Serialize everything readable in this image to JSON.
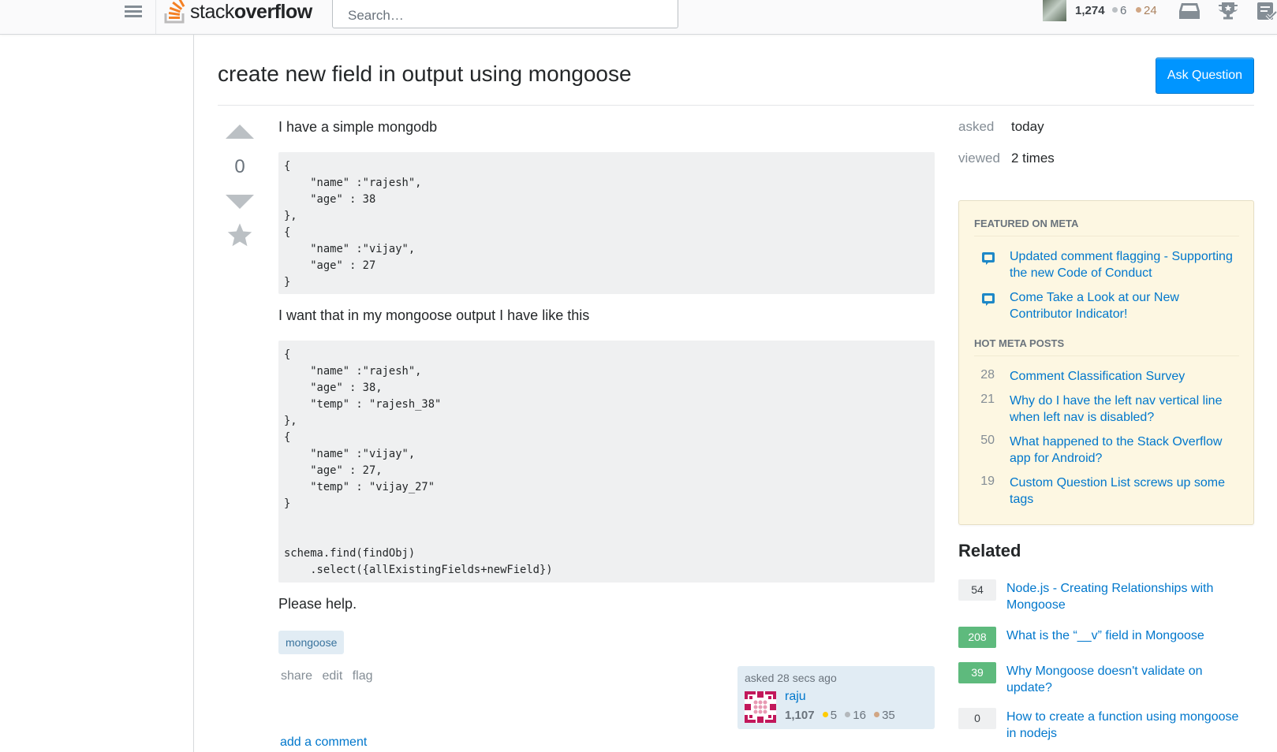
{
  "topbar": {
    "logo_light": "stack",
    "logo_bold": "overflow",
    "search_placeholder": "Search…",
    "reputation": "1,274",
    "silver_badges": "6",
    "bronze_badges": "24",
    "icons": [
      "hamburger-menu-icon",
      "inbox-icon",
      "achievements-trophy-icon",
      "review-queue-icon"
    ]
  },
  "question": {
    "title": "create new field in output using mongoose",
    "ask_button": "Ask Question",
    "votes": "0",
    "intro": "I have a simple mongodb",
    "code1": "{\n    \"name\" :\"rajesh\",\n    \"age\" : 38\n},\n{\n    \"name\" :\"vijay\",\n    \"age\" : 27\n}",
    "middle": "I want that in my mongoose output I have like this",
    "code2": "{\n    \"name\" :\"rajesh\",\n    \"age\" : 38,\n    \"temp\" : \"rajesh_38\"\n},\n{\n    \"name\" :\"vijay\",\n    \"age\" : 27,\n    \"temp\" : \"vijay_27\"\n}\n\n\nschema.find(findObj)\n    .select({allExistingFields+newField})",
    "outro": "Please help.",
    "tags": [
      "mongoose"
    ],
    "menu": {
      "share": "share",
      "edit": "edit",
      "flag": "flag"
    },
    "owner": {
      "asked": "asked 28 secs ago",
      "name": "raju",
      "reputation": "1,107",
      "gold": "5",
      "silver": "16",
      "bronze": "35"
    },
    "add_comment": "add a comment"
  },
  "sidebar": {
    "asked_label": "asked",
    "asked_value": "today",
    "viewed_label": "viewed",
    "viewed_value": "2 times",
    "featured_title": "FEATURED ON META",
    "featured": [
      {
        "icon": "meta-speech-bubble-icon",
        "title": "Updated comment flagging - Supporting the new Code of Conduct"
      },
      {
        "icon": "meta-speech-bubble-icon",
        "title": "Come Take a Look at our New Contributor Indicator!"
      }
    ],
    "hot_title": "HOT META POSTS",
    "hot": [
      {
        "score": "28",
        "title": "Comment Classification Survey"
      },
      {
        "score": "21",
        "title": "Why do I have the left nav vertical line when left nav is disabled?"
      },
      {
        "score": "50",
        "title": "What happened to the Stack Overflow app for Android?"
      },
      {
        "score": "19",
        "title": "Custom Question List screws up some tags"
      }
    ],
    "related_title": "Related",
    "related": [
      {
        "score": "54",
        "answered": false,
        "title": "Node.js - Creating Relationships with Mongoose"
      },
      {
        "score": "208",
        "answered": true,
        "title": "What is the “__v” field in Mongoose"
      },
      {
        "score": "39",
        "answered": true,
        "title": "Why Mongoose doesn't validate on update?"
      },
      {
        "score": "0",
        "answered": false,
        "title": "How to create a function using mongoose in nodejs"
      }
    ]
  },
  "colors": {
    "accent_blue": "#0095ff",
    "link": "#0077cc",
    "logo_orange": "#f48024",
    "answered_green": "#5eba7d",
    "meta_bg": "#fdf7e2",
    "code_bg": "#eff0f1",
    "tag_bg": "#e1ecf4"
  }
}
